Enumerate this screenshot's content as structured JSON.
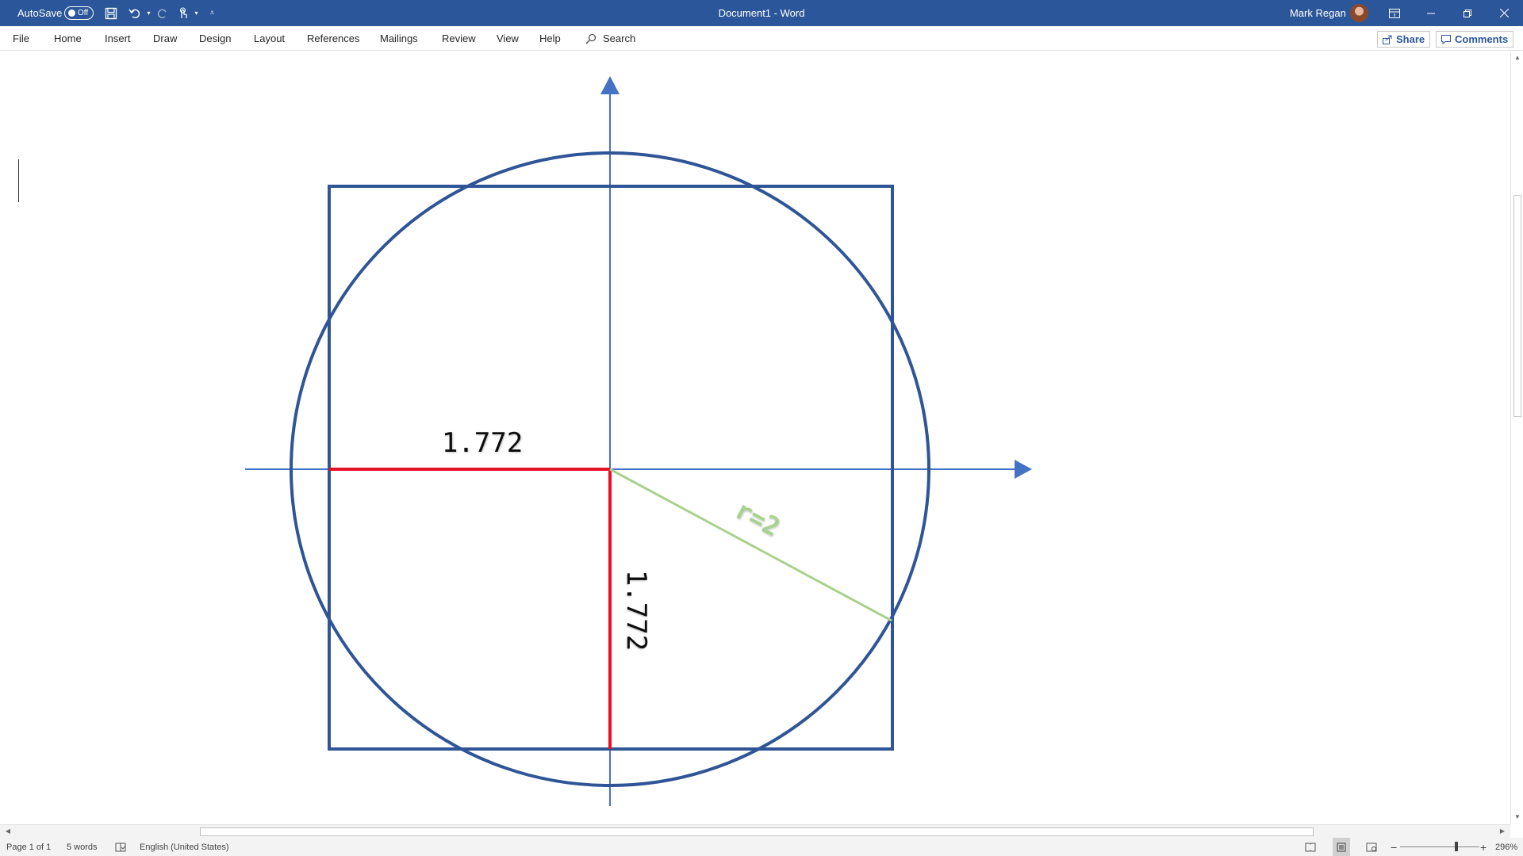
{
  "titlebar": {
    "autosave_label": "AutoSave",
    "autosave_state": "Off",
    "document_title": "Document1  -  Word",
    "user_name": "Mark Regan",
    "accent_color": "#2b579a"
  },
  "ribbon": {
    "tabs": [
      "File",
      "Home",
      "Insert",
      "Draw",
      "Design",
      "Layout",
      "References",
      "Mailings",
      "Review",
      "View",
      "Help"
    ],
    "search_label": "Search",
    "share_label": "Share",
    "comments_label": "Comments"
  },
  "drawing": {
    "horizontal_label": "1.772",
    "vertical_label": "1.772",
    "radius_label": "r=2",
    "shape_color": "#2f5597",
    "axis_color": "#4472c4",
    "half_side_color": "#e81123",
    "radius_color": "#a9d18e"
  },
  "status": {
    "page": "Page 1 of 1",
    "words": "5 words",
    "language": "English (United States)",
    "zoom": "296%"
  }
}
